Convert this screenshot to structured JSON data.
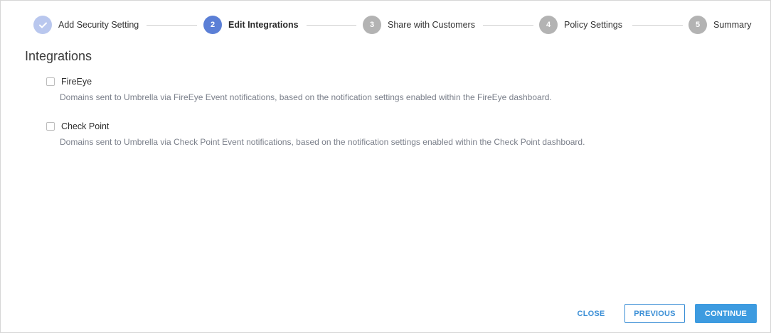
{
  "stepper": {
    "steps": [
      {
        "number": "",
        "label": "Add Security Setting",
        "state": "completed"
      },
      {
        "number": "2",
        "label": "Edit Integrations",
        "state": "active"
      },
      {
        "number": "3",
        "label": "Share with Customers",
        "state": "pending"
      },
      {
        "number": "4",
        "label": "Policy Settings",
        "state": "pending"
      },
      {
        "number": "5",
        "label": "Summary",
        "state": "pending"
      }
    ]
  },
  "main": {
    "title": "Integrations",
    "integrations": [
      {
        "name": "FireEye",
        "checked": false,
        "description": "Domains sent to Umbrella via FireEye Event notifications, based on the notification settings enabled within the FireEye dashboard."
      },
      {
        "name": "Check Point",
        "checked": false,
        "description": "Domains sent to Umbrella via Check Point Event notifications, based on the notification settings enabled within the Check Point dashboard."
      }
    ]
  },
  "footer": {
    "close_label": "CLOSE",
    "previous_label": "PREVIOUS",
    "continue_label": "CONTINUE"
  },
  "colors": {
    "primary": "#3d9be0",
    "active_step": "#5b7fd6",
    "completed_step": "#b9c7ee",
    "pending_step": "#b3b3b3"
  }
}
